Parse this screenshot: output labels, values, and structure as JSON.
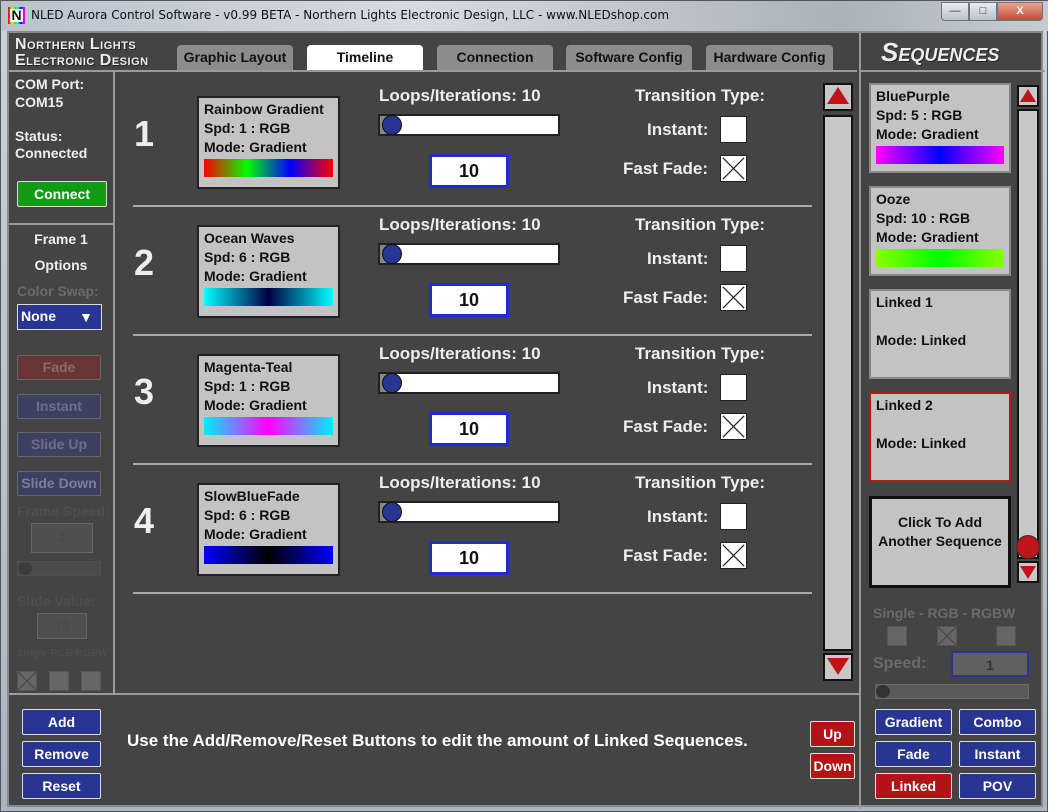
{
  "window": {
    "title": "NLED Aurora Control Software - v0.99 BETA - Northern Lights Electronic Design, LLC - www.NLEDshop.com",
    "app_icon": "N",
    "controls": {
      "minimize": "—",
      "maximize": "□",
      "close": "X"
    }
  },
  "header": {
    "logo_line1": "Northern Lights",
    "logo_line2": "Electronic Design",
    "tabs": [
      {
        "label": "Graphic Layout",
        "active": false
      },
      {
        "label": "Timeline",
        "active": true
      },
      {
        "label": "Connection",
        "active": false
      },
      {
        "label": "Software Config",
        "active": false
      },
      {
        "label": "Hardware Config",
        "active": false
      }
    ],
    "sequences_title": "Sequences"
  },
  "left_panel": {
    "com_port_label": "COM Port:",
    "com_port_value": "COM15",
    "status_label": "Status:",
    "status_value": "Connected",
    "connect_button": "Connect",
    "frame_label": "Frame 1",
    "options_label": "Options",
    "color_swap_label": "Color Swap:",
    "color_swap_value": "None",
    "color_swap_arrow": "▼",
    "transition_buttons": [
      "Fade",
      "Instant",
      "Slide Up",
      "Slide Down"
    ],
    "frame_speed_label": "Frame Speed:",
    "frame_speed_value": "1",
    "slide_value_label": "Slide Value:",
    "slide_value": "10",
    "channel_mode_label": "Single-RGB-RGBW",
    "channel_modes": [
      {
        "name": "Single",
        "checked": true
      },
      {
        "name": "RGB",
        "checked": false
      },
      {
        "name": "RGBW",
        "checked": false
      }
    ]
  },
  "timeline": {
    "loops_label": "Loops/Iterations:",
    "transition_label": "Transition Type:",
    "instant_label": "Instant:",
    "fast_fade_label": "Fast Fade:",
    "rows": [
      {
        "number": "1",
        "name": "Rainbow Gradient",
        "speed": "Spd: 1 : RGB",
        "mode": "Mode: Gradient",
        "loops": "10",
        "loops_fraction": 0.0,
        "instant": false,
        "fast_fade": true,
        "colors": [
          "#ff0000",
          "#00ff00",
          "#0000ff",
          "#ff0000"
        ]
      },
      {
        "number": "2",
        "name": "Ocean Waves",
        "speed": "Spd: 6 : RGB",
        "mode": "Mode: Gradient",
        "loops": "10",
        "loops_fraction": 0.0,
        "instant": false,
        "fast_fade": true,
        "colors": [
          "#00ffff",
          "#000044",
          "#00ffff"
        ]
      },
      {
        "number": "3",
        "name": "Magenta-Teal",
        "speed": "Spd: 1 : RGB",
        "mode": "Mode: Gradient",
        "loops": "10",
        "loops_fraction": 0.0,
        "instant": false,
        "fast_fade": true,
        "colors": [
          "#00eeff",
          "#ff00ff",
          "#00eeff"
        ]
      },
      {
        "number": "4",
        "name": "SlowBlueFade",
        "speed": "Spd: 6 : RGB",
        "mode": "Mode: Gradient",
        "loops": "10",
        "loops_fraction": 0.0,
        "instant": false,
        "fast_fade": true,
        "colors": [
          "#0000ff",
          "#000000",
          "#0000ff"
        ]
      }
    ]
  },
  "sequences": {
    "items": [
      {
        "name": "BluePurple",
        "speed": "Spd: 5 : RGB",
        "mode": "Mode: Gradient",
        "colors": [
          "#ff00ff",
          "#0000ff",
          "#ff00ff"
        ],
        "selected": false
      },
      {
        "name": "Ooze",
        "speed": "Spd: 10 : RGB",
        "mode": "Mode: Gradient",
        "colors": [
          "#88ff00",
          "#00ff00",
          "#88ff00"
        ],
        "selected": false
      },
      {
        "name": "Linked 1",
        "speed": "",
        "mode": "Mode: Linked",
        "colors": [],
        "selected": false
      },
      {
        "name": "Linked 2",
        "speed": "",
        "mode": "Mode: Linked",
        "colors": [],
        "selected": true
      }
    ],
    "add_label": "Click To Add Another Sequence",
    "channel_mode_label": "Single - RGB - RGBW",
    "channel_modes": [
      {
        "name": "Single",
        "checked": false
      },
      {
        "name": "RGB",
        "checked": true
      },
      {
        "name": "RGBW",
        "checked": false
      }
    ],
    "speed_label": "Speed:",
    "speed_value": "1",
    "mode_buttons": [
      {
        "label": "Gradient",
        "active": false
      },
      {
        "label": "Combo",
        "active": false
      },
      {
        "label": "Fade",
        "active": false
      },
      {
        "label": "Instant",
        "active": false
      },
      {
        "label": "Linked",
        "active": true
      },
      {
        "label": "POV",
        "active": false
      }
    ],
    "scroll_fraction": 1.0
  },
  "footer": {
    "add_button": "Add",
    "remove_button": "Remove",
    "reset_button": "Reset",
    "message": "Use the Add/Remove/Reset Buttons to edit the amount of Linked Sequences.",
    "up_button": "Up",
    "down_button": "Down"
  }
}
